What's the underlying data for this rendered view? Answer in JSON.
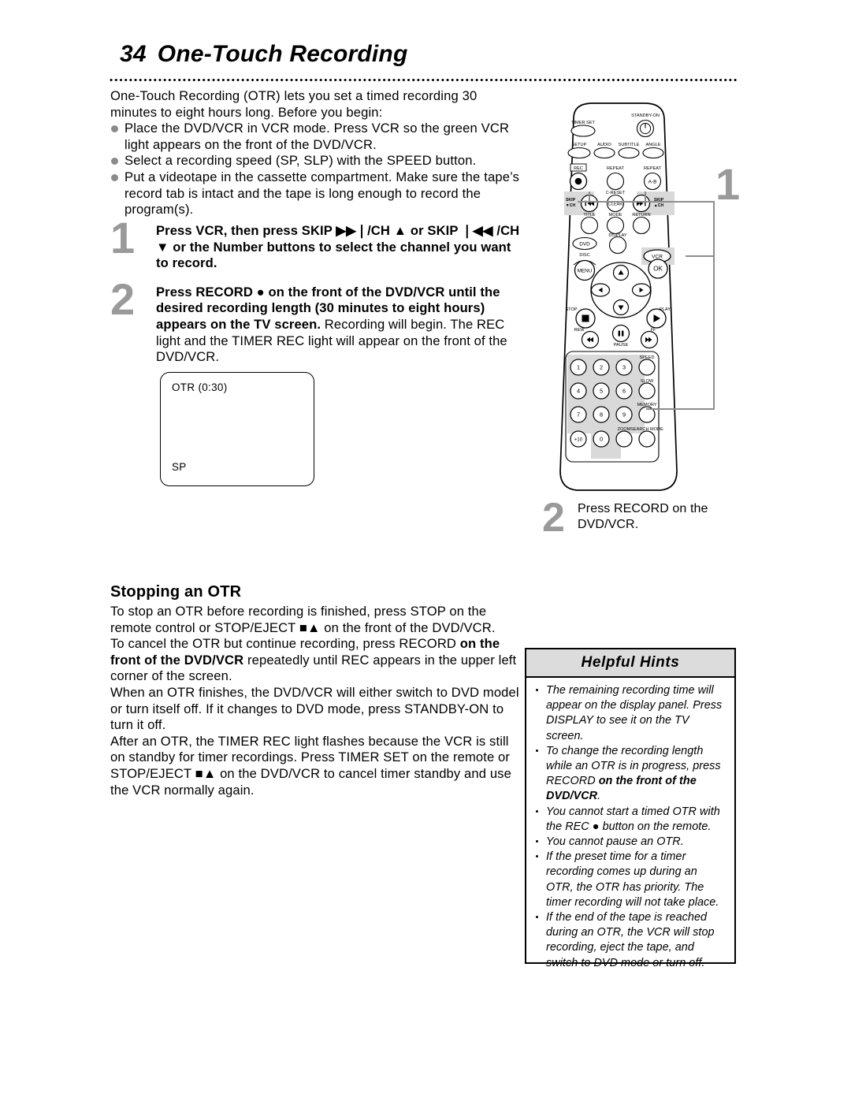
{
  "header": {
    "page_number": "34",
    "title": "One-Touch Recording"
  },
  "intro": {
    "paragraph": "One-Touch Recording (OTR) lets you set a timed recording 30 minutes to eight hours long. Before you begin:",
    "bullets": [
      "Place the DVD/VCR in VCR mode. Press VCR so the green VCR light appears on the front of the DVD/VCR.",
      "Select a recording speed (SP, SLP) with the SPEED button.",
      "Put a videotape in the cassette compartment. Make sure the tape’s record tab is intact and the tape is long enough to record the program(s)."
    ]
  },
  "steps": [
    {
      "number": "1",
      "bold_text": "Press VCR, then press SKIP ▶▶❘/CH ▲ or SKIP ❘◀◀ /CH ▼ or the Number buttons to select the channel you want to record.",
      "normal_text": ""
    },
    {
      "number": "2",
      "bold_text": "Press RECORD ● on the front of the DVD/VCR until the desired recording length (30 minutes to eight hours) appears on the TV screen.",
      "normal_text": " Recording will begin. The REC light and the TIMER REC light will appear on the front of the DVD/VCR."
    }
  ],
  "tv_screen": {
    "osd_top": "OTR (0:30)",
    "osd_bottom": "SP"
  },
  "section_stopping": {
    "heading": "Stopping an OTR",
    "paragraphs": [
      {
        "pre": "To stop an OTR before recording is finished, press STOP on the remote control or STOP/EJECT ■▲ on the front of the DVD/VCR.",
        "bold": "",
        "post": ""
      },
      {
        "pre": "To cancel the OTR but continue recording, press RECORD ",
        "bold": "on the front of the DVD/VCR",
        "post": " repeatedly until REC appears in the upper left corner of the screen."
      },
      {
        "pre": "When an OTR finishes, the DVD/VCR will either switch to DVD model or turn itself off. If it changes to DVD mode, press STANDBY-ON to turn it off.",
        "bold": "",
        "post": ""
      },
      {
        "pre": "After an OTR, the TIMER REC light flashes because the VCR is still on standby for timer recordings. Press TIMER SET on the remote or STOP/EJECT ■▲ on the DVD/VCR to cancel timer standby and use the VCR normally again.",
        "bold": "",
        "post": ""
      }
    ]
  },
  "callouts": {
    "one": "1",
    "two_number": "2",
    "two_caption": "Press RECORD on the DVD/VCR."
  },
  "hints": {
    "title": "Helpful Hints",
    "items": [
      {
        "pre": "The remaining recording time will appear on the display panel. Press DISPLAY to see it on the TV screen.",
        "bold": "",
        "post": ""
      },
      {
        "pre": "To change the recording length while an OTR is in progress, press RECORD ",
        "bold": "on the front of the DVD/VCR",
        "post": "."
      },
      {
        "pre": "You cannot start a timed OTR with the REC ● button on the remote.",
        "bold": "",
        "post": ""
      },
      {
        "pre": "You cannot pause an OTR.",
        "bold": "",
        "post": ""
      },
      {
        "pre": "If the preset time for a timer recording comes up during an OTR, the OTR has priority. The timer recording will not take place.",
        "bold": "",
        "post": ""
      },
      {
        "pre": "If the end of the tape is reached during an OTR, the VCR will stop recording, eject the tape, and switch to DVD mode or turn off.",
        "bold": "",
        "post": ""
      }
    ]
  },
  "remote": {
    "labels": {
      "timer_set": "TIMER SET",
      "standby_on": "STANDBY-ON",
      "setup": "SETUP",
      "audio": "AUDIO",
      "subtitle": "SUBTITLE",
      "angle": "ANGLE",
      "rec": "REC",
      "repeat": "REPEAT",
      "repeat_ab": "REPEAT",
      "ab": "A-B",
      "c_reset": "C-RESET",
      "clear": "CLEAR",
      "skip_down": "SKIP",
      "ch_down": "▼CH",
      "skip_up": "SKIP",
      "ch_up": "▲CH",
      "title": "TITLE",
      "mode": "MODE",
      "return": "RETURN",
      "dvd": "DVD",
      "display": "DISPLAY",
      "vcr": "VCR",
      "disc": "DISC",
      "menu": "MENU",
      "ok": "OK",
      "stop": "STOP",
      "play": "PLAY",
      "rew": "REW",
      "pause": "PAUSE",
      "ff": "FF",
      "speed": "SPEED",
      "slow": "SLOW",
      "memory": "MEMORY",
      "zoom": "ZOOM",
      "search_mode": "SEARCH MODE",
      "plus_ten": "+10"
    },
    "numbers": [
      "1",
      "2",
      "3",
      "4",
      "5",
      "6",
      "7",
      "8",
      "9",
      "0"
    ]
  },
  "colors": {
    "accent_grey": "#9a9a9a",
    "hint_header_bg": "#dcdcdc",
    "highlight": "#d9d9d9"
  }
}
